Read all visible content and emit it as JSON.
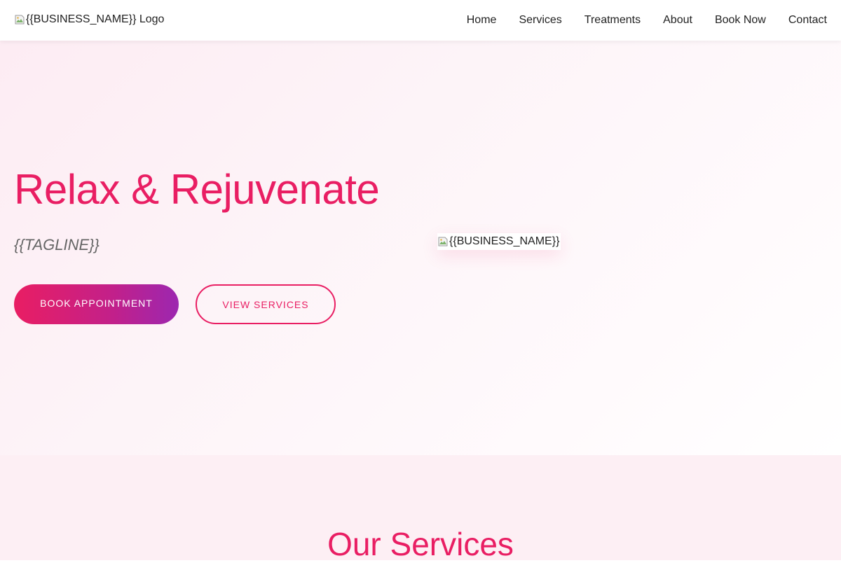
{
  "header": {
    "logo_alt": "{{BUSINESS_NAME}} Logo",
    "nav": [
      {
        "label": "Home"
      },
      {
        "label": "Services"
      },
      {
        "label": "Treatments"
      },
      {
        "label": "About"
      },
      {
        "label": "Book Now"
      },
      {
        "label": "Contact"
      }
    ]
  },
  "hero": {
    "title": "Relax & Rejuvenate",
    "tagline": "{{TAGLINE}}",
    "primary_button": "Book Appointment",
    "secondary_button": "View Services",
    "image_alt": "{{BUSINESS_NAME}}"
  },
  "services": {
    "title": "Our Services"
  },
  "colors": {
    "accent": "#e91e63",
    "accent_secondary": "#9c27b0",
    "hero_bg": "#fdecf3",
    "services_bg": "#fdeff4"
  },
  "icons": {
    "logo": "broken-image-icon",
    "hero_image": "broken-image-icon"
  }
}
